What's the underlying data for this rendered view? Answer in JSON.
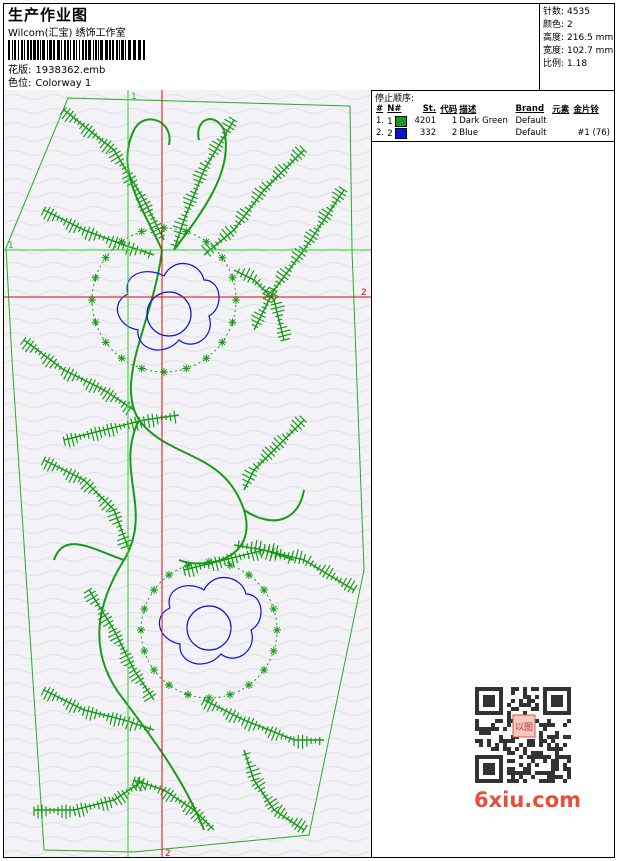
{
  "header": {
    "title": "生产作业图",
    "company": "Wilcom(汇宝) 绣饰工作室",
    "design_label": "花版:",
    "design_file": "1938362.emb",
    "colorway_label": "色位:",
    "colorway": "Colorway 1"
  },
  "stats": [
    {
      "label": "针数:",
      "value": "4535"
    },
    {
      "label": "颜色:",
      "value": "2"
    },
    {
      "label": "高度:",
      "value": "216.5 mm"
    },
    {
      "label": "宽度:",
      "value": "102.7 mm"
    },
    {
      "label": "比例:",
      "value": "1.18"
    }
  ],
  "guides": {
    "h1": "1",
    "h2": "2",
    "v1": "1",
    "v2": "2"
  },
  "stop_sequence": {
    "title": "停止顺序:",
    "columns": [
      "#",
      "N#",
      "St.",
      "代码",
      "描述",
      "Brand",
      "元素",
      "金片铃"
    ],
    "rows": [
      {
        "idx": "1.",
        "n": "1",
        "color": "#1a9a1a",
        "stitches": "4201",
        "code": "1",
        "desc": "Dark Green",
        "brand": "Default",
        "element": "",
        "sequin": ""
      },
      {
        "idx": "2.",
        "n": "2",
        "color": "#0a14d8",
        "stitches": "332",
        "code": "2",
        "desc": "Blue",
        "brand": "Default",
        "element": "",
        "sequin": "#1 (76)"
      }
    ]
  },
  "watermark": {
    "text": "6xiu.com",
    "seal": "以图"
  },
  "colors": {
    "green": "#1a9a1a",
    "blue": "#0a14d8",
    "guide_red": "#d01010",
    "guide_green": "#33cc33"
  }
}
